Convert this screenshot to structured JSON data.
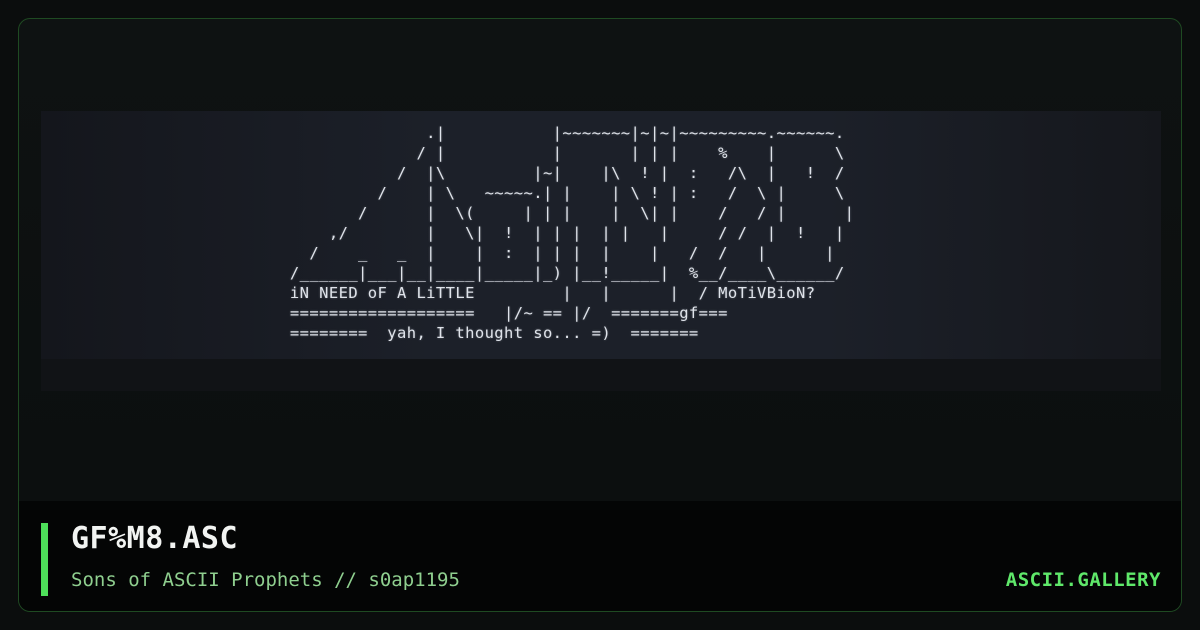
{
  "artwork": {
    "ascii_lines": [
      "                  .|           |~~~~~~~|~|~|~~~~~~~~~.~~~~~~.",
      "                 / |           |       | | |    %    |      \\",
      "               /  |\\         |~|    |\\  ! |  :   /\\  |   !  /",
      "             /    | \\   ~~~~~.| |    | \\ ! | :   /  \\ |     \\",
      "           /      |  \\(     | | |    |  \\| |    /   / |      |",
      "        ,/        |   \\|  !  | | |  | |   |     / /  |  !   |",
      "      /    _   _  |    |  :  | | |  |    |   /  /   |      |",
      "    /______|___|__|____|_____|_) |__!_____|  %__/____\\______/",
      "    iN NEED oF A LiTTLE         |   |      |  / MoTiVBioN?",
      "    ===================   |/~ == |/  =======gf===",
      "    ========  yah, I thought so... =)  ======="
    ]
  },
  "footer": {
    "title": "GF%M8.ASC",
    "subtitle": "Sons of ASCII Prophets // s0ap1195",
    "brand": "ASCII.GALLERY"
  },
  "colors": {
    "accent": "#4ee05a",
    "brand": "#5fe86a",
    "subtitle": "#8fcf8f",
    "border": "#1f4a22"
  }
}
